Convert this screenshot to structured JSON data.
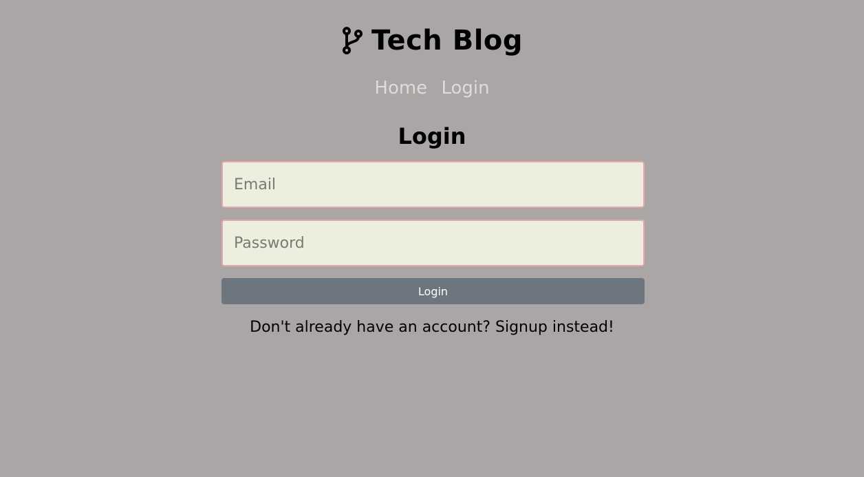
{
  "header": {
    "icon": "git-branch-icon",
    "title": "Tech Blog"
  },
  "nav": {
    "items": [
      {
        "label": "Home"
      },
      {
        "label": "Login"
      }
    ],
    "link_color": "#dedcdb"
  },
  "main": {
    "heading": "Login",
    "form": {
      "email": {
        "placeholder": "Email",
        "value": ""
      },
      "password": {
        "placeholder": "Password",
        "value": ""
      },
      "submit_label": "Login"
    },
    "signup_link": "Don't already have an account? Signup instead!"
  },
  "colors": {
    "background": "#aaa6a5",
    "input_background": "#eeeedf",
    "input_border": "#e8a7ad",
    "button_background": "#6d757e"
  }
}
